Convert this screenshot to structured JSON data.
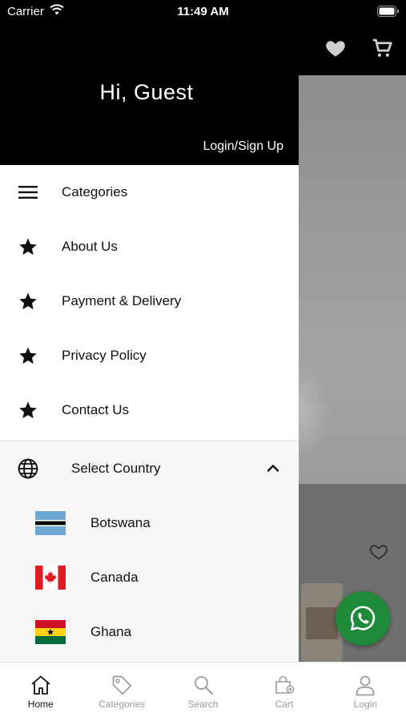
{
  "status_bar": {
    "carrier": "Carrier",
    "time": "11:49 AM"
  },
  "drawer": {
    "greeting": "Hi, Guest",
    "login_link": "Login/Sign Up",
    "menu_items": [
      {
        "label": "Categories",
        "icon": "hamburger-icon"
      },
      {
        "label": "About Us",
        "icon": "star-icon"
      },
      {
        "label": "Payment & Delivery",
        "icon": "star-icon"
      },
      {
        "label": "Privacy Policy",
        "icon": "star-icon"
      },
      {
        "label": "Contact Us",
        "icon": "star-icon"
      }
    ],
    "country_selector": {
      "label": "Select Country",
      "expanded": true,
      "countries": [
        {
          "name": "Botswana",
          "flag": "botswana-flag"
        },
        {
          "name": "Canada",
          "flag": "canada-flag"
        },
        {
          "name": "Ghana",
          "flag": "ghana-flag"
        }
      ]
    }
  },
  "tab_bar": {
    "items": [
      {
        "label": "Home",
        "icon": "home-icon",
        "active": true
      },
      {
        "label": "Categories",
        "icon": "tag-icon",
        "active": false
      },
      {
        "label": "Search",
        "icon": "search-icon",
        "active": false
      },
      {
        "label": "Cart",
        "icon": "cart-icon",
        "active": false
      },
      {
        "label": "Login",
        "icon": "user-icon",
        "active": false
      }
    ]
  },
  "colors": {
    "header": "#000000",
    "whatsapp": "#1e8a3a",
    "active_tab": "#111111",
    "inactive_tab": "#9a9a9a"
  }
}
